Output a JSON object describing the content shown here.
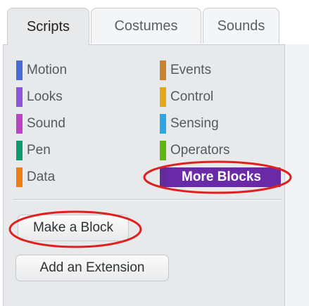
{
  "tabs": [
    {
      "label": "Scripts",
      "active": true
    },
    {
      "label": "Costumes",
      "active": false
    },
    {
      "label": "Sounds",
      "active": false
    }
  ],
  "categories": {
    "left": [
      {
        "label": "Motion",
        "color": "#4a6cd4"
      },
      {
        "label": "Looks",
        "color": "#8a55d7"
      },
      {
        "label": "Sound",
        "color": "#bb42c3"
      },
      {
        "label": "Pen",
        "color": "#0e9a6c"
      },
      {
        "label": "Data",
        "color": "#ee7d16"
      }
    ],
    "right": [
      {
        "label": "Events",
        "color": "#c88330"
      },
      {
        "label": "Control",
        "color": "#e1a91a"
      },
      {
        "label": "Sensing",
        "color": "#2ca5e2"
      },
      {
        "label": "Operators",
        "color": "#5cb712"
      },
      {
        "label": "More Blocks",
        "color": "#632d99",
        "selected": true
      }
    ]
  },
  "buttons": {
    "make_block": "Make a Block",
    "add_extension": "Add an Extension"
  },
  "annotation_color": "#e0201e"
}
